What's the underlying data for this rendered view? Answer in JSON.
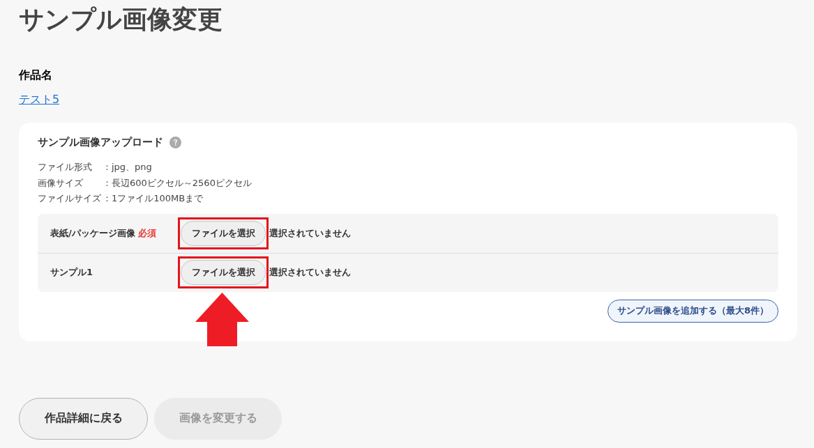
{
  "page": {
    "title": "サンプル画像変更"
  },
  "work": {
    "label": "作品名",
    "link": "テスト5"
  },
  "upload": {
    "heading": "サンプル画像アップロード",
    "specs": [
      {
        "label": "ファイル形式",
        "value": "：jpg、png"
      },
      {
        "label": "画像サイズ",
        "value": "：長辺600ピクセル～2560ピクセル"
      },
      {
        "label": "ファイルサイズ",
        "value": "：1ファイル100MBまで"
      }
    ],
    "required_label": "必須",
    "rows": [
      {
        "label": "表紙/パッケージ画像",
        "required": true,
        "button": "ファイルを選択",
        "status": "選択されていません",
        "highlighted": true
      },
      {
        "label": "サンプル1",
        "required": false,
        "button": "ファイルを選択",
        "status": "選択されていません",
        "highlighted": true
      }
    ],
    "arrow": true,
    "add_button": "サンプル画像を追加する（最大8件）"
  },
  "actions": [
    {
      "label": "作品詳細に戻る",
      "disabled": false
    },
    {
      "label": "画像を変更する",
      "disabled": true
    }
  ]
}
